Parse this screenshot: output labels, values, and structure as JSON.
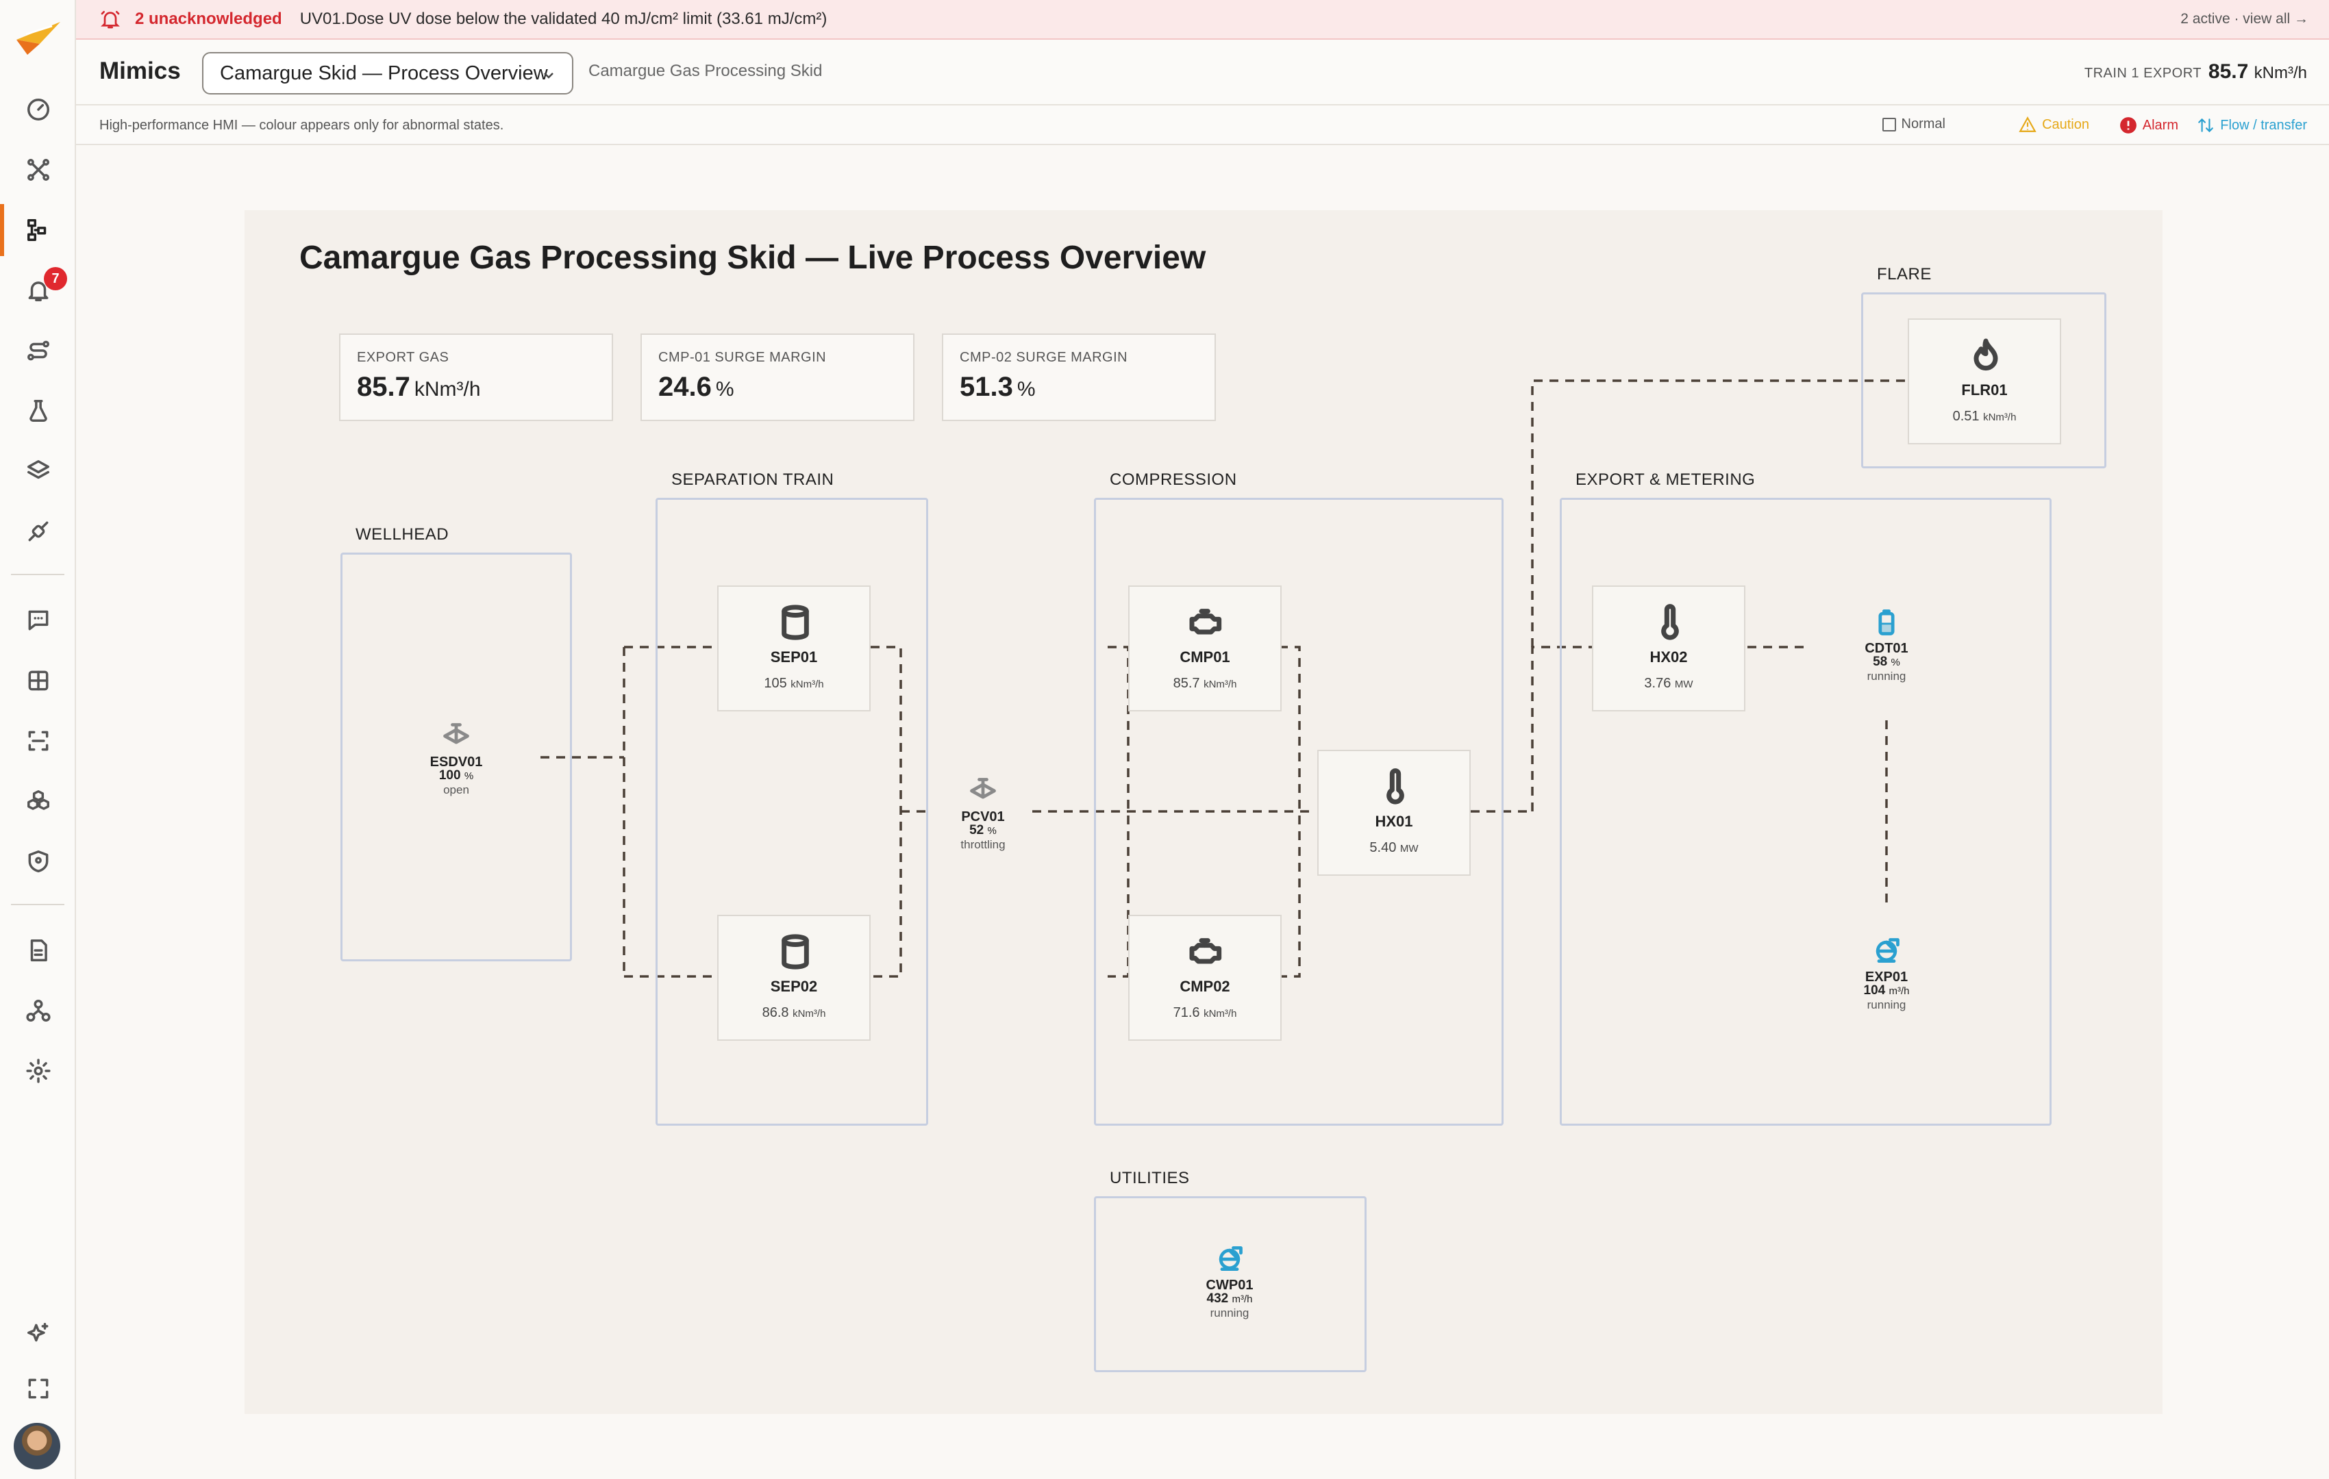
{
  "sidebar": {
    "icons": [
      "logo-icon",
      "dashboard-icon",
      "topology-icon",
      "mimics-icon",
      "alarms-icon",
      "routes-icon",
      "lab-icon",
      "layers-icon",
      "integrations-icon",
      "chat-icon",
      "tables-icon",
      "scan-icon",
      "assets-icon",
      "security-icon",
      "reports-icon",
      "org-icon",
      "settings-icon",
      "ai-sparkle-icon",
      "fullscreen-icon"
    ],
    "alarm_badge": "7"
  },
  "alert_bar": {
    "count": "2 unacknowledged",
    "message": "UV01.Dose UV dose below the validated 40 mJ/cm² limit (33.61 mJ/cm²)",
    "right": "2 active · view all →"
  },
  "header": {
    "title": "Mimics",
    "selected_mimic": "Camargue Skid — Process Overview",
    "subtitle": "Camargue Gas Processing Skid",
    "export_label": "TRAIN 1 EXPORT",
    "export_value": "85.7",
    "export_unit": "kNm³/h"
  },
  "legend": {
    "note": "High-performance HMI — colour appears only for abnormal states.",
    "normal": "Normal",
    "caution": "Caution",
    "alarm": "Alarm",
    "flow": "Flow / transfer",
    "colors": {
      "caution": "#e6a817",
      "alarm": "#d4272e",
      "flow": "#2aa0d0"
    }
  },
  "canvas": {
    "title": "Camargue Gas Processing Skid — Live Process Overview",
    "kpis": [
      {
        "label": "EXPORT GAS",
        "value": "85.7",
        "unit": "kNm³/h"
      },
      {
        "label": "CMP-01 SURGE MARGIN",
        "value": "24.6",
        "unit": "%"
      },
      {
        "label": "CMP-02 SURGE MARGIN",
        "value": "51.3",
        "unit": "%"
      }
    ],
    "groups": {
      "wellhead": "WELLHEAD",
      "separation": "SEPARATION TRAIN",
      "compression": "COMPRESSION",
      "export": "EXPORT & METERING",
      "flare": "FLARE",
      "utilities": "UTILITIES"
    },
    "equipment": {
      "sep01": {
        "tag": "SEP01",
        "value": "105",
        "unit": "kNm³/h",
        "icon": "vessel-icon"
      },
      "sep02": {
        "tag": "SEP02",
        "value": "86.8",
        "unit": "kNm³/h",
        "icon": "vessel-icon"
      },
      "cmp01": {
        "tag": "CMP01",
        "value": "85.7",
        "unit": "kNm³/h",
        "icon": "compressor-icon"
      },
      "cmp02": {
        "tag": "CMP02",
        "value": "71.6",
        "unit": "kNm³/h",
        "icon": "compressor-icon"
      },
      "hx01": {
        "tag": "HX01",
        "value": "5.40",
        "unit": "MW",
        "icon": "thermometer-icon"
      },
      "hx02": {
        "tag": "HX02",
        "value": "3.76",
        "unit": "MW",
        "icon": "thermometer-icon"
      },
      "flr01": {
        "tag": "FLR01",
        "value": "0.51",
        "unit": "kNm³/h",
        "icon": "flame-icon"
      }
    },
    "devices": {
      "esdv01": {
        "tag": "ESDV01",
        "value": "100",
        "unit": "%",
        "state": "open",
        "icon": "valve-icon"
      },
      "pcv01": {
        "tag": "PCV01",
        "value": "52",
        "unit": "%",
        "state": "throttling",
        "icon": "valve-icon"
      },
      "cdt01": {
        "tag": "CDT01",
        "value": "58",
        "unit": "%",
        "state": "running",
        "icon": "tank-icon"
      },
      "exp01": {
        "tag": "EXP01",
        "value": "104",
        "unit": "m³/h",
        "state": "running",
        "icon": "pump-icon"
      },
      "cwp01": {
        "tag": "CWP01",
        "value": "432",
        "unit": "m³/h",
        "state": "running",
        "icon": "pump-icon"
      }
    }
  }
}
